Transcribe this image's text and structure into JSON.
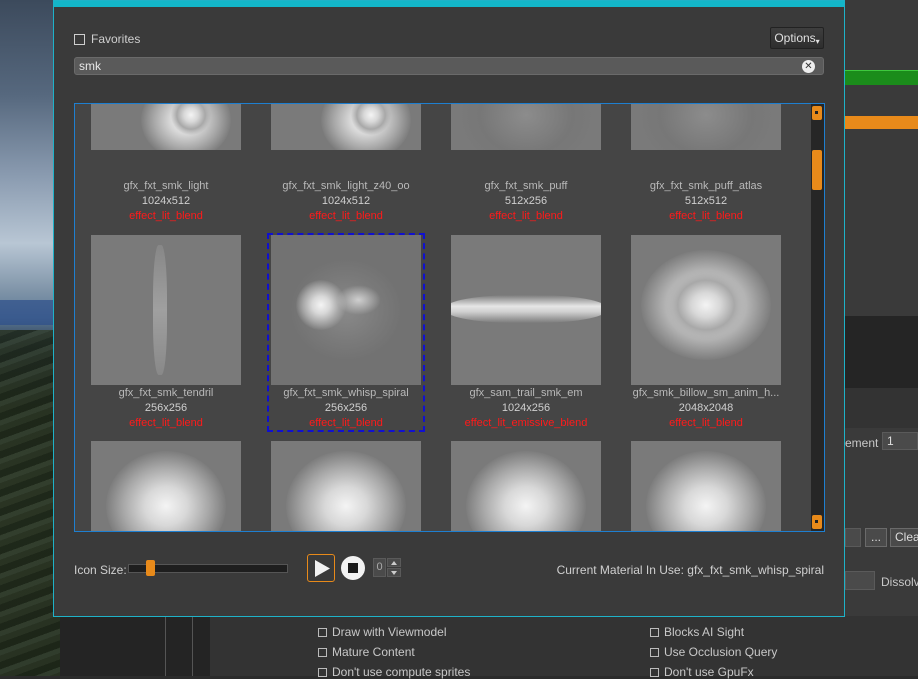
{
  "dialog": {
    "favorites_label": "Favorites",
    "options_label": "Options",
    "search_value": "smk",
    "icon_size_label": "Icon Size:",
    "icon_size_level_percent": 14,
    "frame_spinner_value": "0",
    "current_material_label": "Current Material In Use: gfx_fxt_smk_whisp_spiral"
  },
  "materials": [
    {
      "name": "gfx_fxt_smk_light",
      "dims": "1024x512",
      "material": "effect_lit_blend",
      "selected": false
    },
    {
      "name": "gfx_fxt_smk_light_z40_oo",
      "dims": "1024x512",
      "material": "effect_lit_blend",
      "selected": false
    },
    {
      "name": "gfx_fxt_smk_puff",
      "dims": "512x256",
      "material": "effect_lit_blend",
      "selected": false
    },
    {
      "name": "gfx_fxt_smk_puff_atlas",
      "dims": "512x512",
      "material": "effect_lit_blend",
      "selected": false
    },
    {
      "name": "gfx_fxt_smk_tendril",
      "dims": "256x256",
      "material": "effect_lit_blend",
      "selected": false
    },
    {
      "name": "gfx_fxt_smk_whisp_spiral",
      "dims": "256x256",
      "material": "effect_lit_blend",
      "selected": true
    },
    {
      "name": "gfx_sam_trail_smk_em",
      "dims": "1024x256",
      "material": "effect_lit_emissive_blend",
      "selected": false
    },
    {
      "name": "gfx_smk_billow_sm_anim_h...",
      "dims": "2048x2048",
      "material": "effect_lit_blend",
      "selected": false
    }
  ],
  "background_panel": {
    "element_label": "ement",
    "element_value": "1",
    "dots_label": "...",
    "clear_label": "Clear",
    "dissolve_label": "Dissolve",
    "checkboxes": [
      {
        "label": "Draw with Viewmodel"
      },
      {
        "label": "Mature Content"
      },
      {
        "label": "Don't use compute sprites"
      },
      {
        "label": "Blocks AI Sight"
      },
      {
        "label": "Use Occlusion Query"
      },
      {
        "label": "Don't use GpuFx"
      }
    ]
  },
  "colors": {
    "accent_cyan": "#13b6c9",
    "accent_orange": "#e88a1a",
    "material_red": "#ff1a1a",
    "selection_blue": "#1010d0"
  }
}
